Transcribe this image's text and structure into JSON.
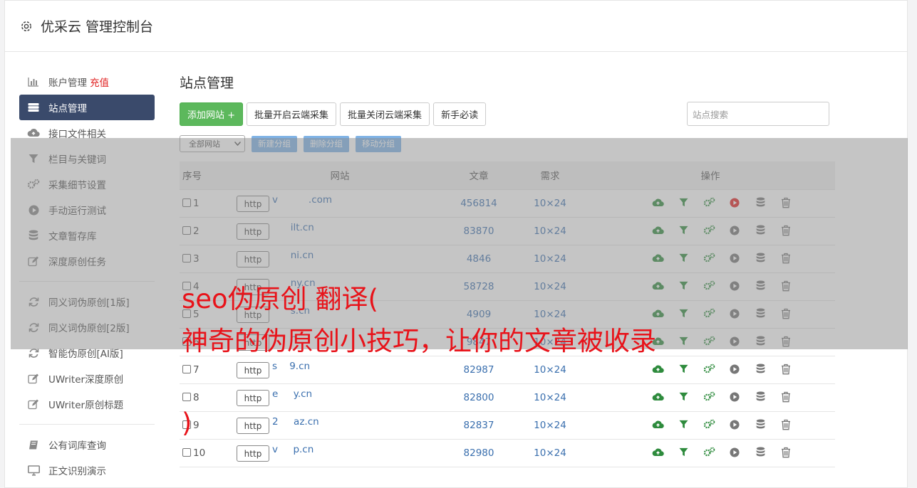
{
  "header": {
    "title": "优采云 管理控制台"
  },
  "sidebar": {
    "group1": [
      {
        "label": "账户管理",
        "extra": "充值",
        "icon": "bar-chart-icon"
      },
      {
        "label": "站点管理",
        "icon": "server-icon",
        "active": true
      },
      {
        "label": "接口文件相关",
        "icon": "cloud-icon"
      },
      {
        "label": "栏目与关键词",
        "icon": "filter-icon"
      },
      {
        "label": "采集细节设置",
        "icon": "gears-icon"
      },
      {
        "label": "手动运行测试",
        "icon": "play-icon"
      },
      {
        "label": "文章暂存库",
        "icon": "database-icon"
      },
      {
        "label": "深度原创任务",
        "icon": "edit-icon"
      }
    ],
    "group2": [
      {
        "label": "同义词伪原创[1版]",
        "icon": "refresh-icon"
      },
      {
        "label": "同义词伪原创[2版]",
        "icon": "refresh-icon"
      },
      {
        "label": "智能伪原创[AI版]",
        "icon": "refresh-icon"
      },
      {
        "label": "UWriter深度原创",
        "icon": "edit-icon"
      },
      {
        "label": "UWriter原创标题",
        "icon": "edit-icon"
      }
    ],
    "group3": [
      {
        "label": "公有词库查询",
        "icon": "book-icon"
      },
      {
        "label": "正文识别演示",
        "icon": "monitor-icon"
      }
    ]
  },
  "main": {
    "title": "站点管理",
    "toolbar": {
      "add_site": "添加网站 +",
      "batch_on": "批量开启云端采集",
      "batch_off": "批量关闭云端采集",
      "guide": "新手必读"
    },
    "search": {
      "placeholder": "站点搜索"
    },
    "group_select": "全部网站",
    "group_buttons": {
      "new": "新建分组",
      "delete": "删除分组",
      "move": "移动分组"
    },
    "table": {
      "headers": {
        "no": "序号",
        "site": "网站",
        "articles": "文章",
        "demand": "需求",
        "ops": "操作"
      },
      "rows": [
        {
          "no": "1",
          "proto": "http",
          "domain": "v          .com",
          "articles": "456814",
          "demand": "10×24",
          "run_active": true
        },
        {
          "no": "2",
          "proto": "http",
          "domain": "      ilt.cn",
          "articles": "83870",
          "demand": "10×24"
        },
        {
          "no": "3",
          "proto": "http",
          "domain": "      ni.cn",
          "articles": "4846",
          "demand": "10×24"
        },
        {
          "no": "4",
          "proto": "http",
          "domain": "      ny.cn",
          "articles": "58728",
          "demand": "10×24"
        },
        {
          "no": "5",
          "proto": "http",
          "domain": "      s.cn",
          "articles": "4909",
          "demand": "10×24"
        },
        {
          "no": "6",
          "proto": "http",
          "domain": "      n",
          "articles": "9847",
          "demand": "10×24"
        },
        {
          "no": "7",
          "proto": "http",
          "domain": "s    9.cn",
          "articles": "82987",
          "demand": "10×24"
        },
        {
          "no": "8",
          "proto": "http",
          "domain": "e     y.cn",
          "articles": "82800",
          "demand": "10×24"
        },
        {
          "no": "9",
          "proto": "http",
          "domain": "2     az.cn",
          "articles": "82837",
          "demand": "10×24"
        },
        {
          "no": "10",
          "proto": "http",
          "domain": "v     p.cn",
          "articles": "82980",
          "demand": "10×24"
        }
      ]
    }
  },
  "watermark": {
    "line1": "seo伪原创 翻译(",
    "line2": "神奇的伪原创小技巧，让你的文章被收录",
    "line3": ")"
  },
  "colors": {
    "accent": "#3a4a6b",
    "green": "#5cb85c",
    "link": "#3a6fae",
    "watermark": "#e8131a"
  }
}
